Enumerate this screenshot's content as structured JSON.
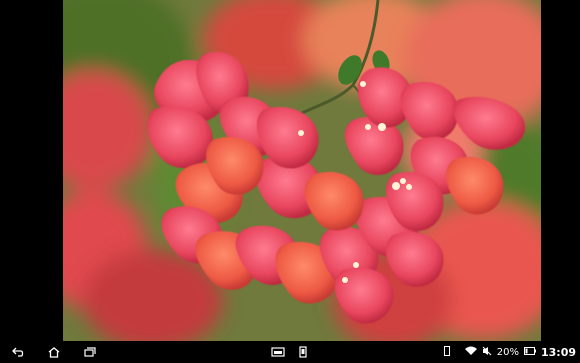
{
  "photo": {
    "subject": "bougainvillea"
  },
  "navbar": {
    "back_icon": "back-icon",
    "home_icon": "home-icon",
    "recents_icon": "recent-apps-icon",
    "window_icon": "small-apps-icon",
    "screenshot_icon": "screenshot-icon"
  },
  "status": {
    "battery_percent": "20%",
    "time": "13:09",
    "icons": [
      "notification-icon",
      "wifi-icon",
      "mute-icon",
      "battery-icon"
    ]
  }
}
